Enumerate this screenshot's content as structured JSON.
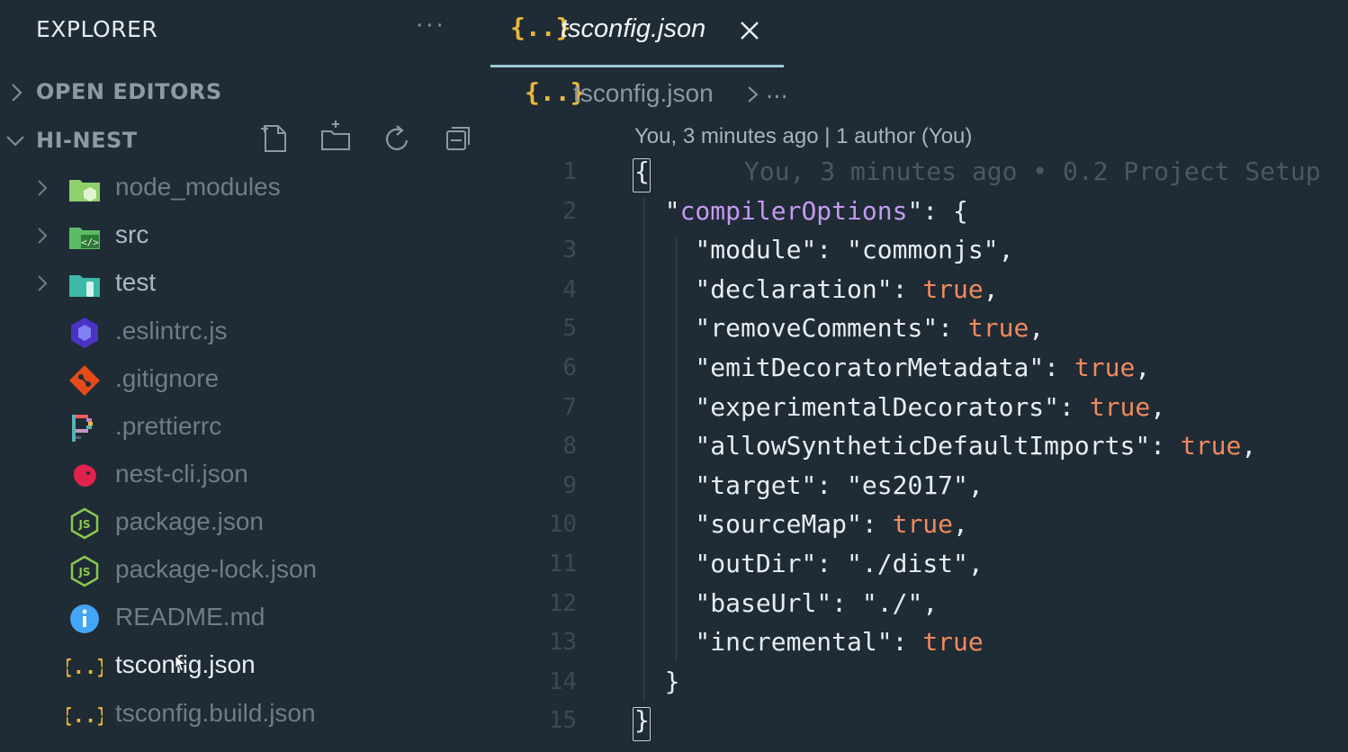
{
  "sidebar": {
    "title": "EXPLORER",
    "more_label": "···",
    "open_editors_label": "OPEN EDITORS",
    "project_label": "HI-NEST",
    "actions": [
      "new-file",
      "new-folder",
      "refresh",
      "collapse-all"
    ],
    "items": [
      {
        "name": "node_modules",
        "type": "folder",
        "icon": "node-modules-folder-icon",
        "color": "#8fd16a"
      },
      {
        "name": "src",
        "type": "folder",
        "icon": "src-folder-icon",
        "color": "#5dbb63"
      },
      {
        "name": "test",
        "type": "folder",
        "icon": "test-folder-icon",
        "color": "#3bb9a6"
      },
      {
        "name": ".eslintrc.js",
        "type": "file",
        "icon": "eslint-icon",
        "color": "#4b32c3"
      },
      {
        "name": ".gitignore",
        "type": "file",
        "icon": "git-icon",
        "color": "#e64a19"
      },
      {
        "name": ".prettierrc",
        "type": "file",
        "icon": "prettier-icon",
        "color": "#c596c7"
      },
      {
        "name": "nest-cli.json",
        "type": "file",
        "icon": "nestjs-icon",
        "color": "#e0234e"
      },
      {
        "name": "package.json",
        "type": "file",
        "icon": "nodejs-icon",
        "color": "#8cc84b"
      },
      {
        "name": "package-lock.json",
        "type": "file",
        "icon": "nodejs-icon",
        "color": "#8cc84b"
      },
      {
        "name": "README.md",
        "type": "file",
        "icon": "info-icon",
        "color": "#42a5f5"
      },
      {
        "name": "tsconfig.json",
        "type": "file",
        "icon": "json-icon",
        "color": "#e8b73c",
        "active": true
      },
      {
        "name": "tsconfig.build.json",
        "type": "file",
        "icon": "json-icon",
        "color": "#e8b73c"
      }
    ]
  },
  "tab": {
    "icon_text": "{..}",
    "label": "tsconfig.json"
  },
  "breadcrumb": {
    "icon_text": "{..}",
    "file": "tsconfig.json",
    "more": "..."
  },
  "codelens": "You, 3 minutes ago | 1 author (You)",
  "blame_ghost": "You, 3 minutes ago • 0.2 Project Setup",
  "line_numbers": [
    "1",
    "2",
    "3",
    "4",
    "5",
    "6",
    "7",
    "8",
    "9",
    "10",
    "11",
    "12",
    "13",
    "14",
    "15"
  ],
  "code": {
    "compiler_key": "compilerOptions",
    "entries": [
      {
        "key": "module",
        "value": "commonjs",
        "kind": "string",
        "comma": true
      },
      {
        "key": "declaration",
        "value": "true",
        "kind": "bool",
        "comma": true
      },
      {
        "key": "removeComments",
        "value": "true",
        "kind": "bool",
        "comma": true
      },
      {
        "key": "emitDecoratorMetadata",
        "value": "true",
        "kind": "bool",
        "comma": true
      },
      {
        "key": "experimentalDecorators",
        "value": "true",
        "kind": "bool",
        "comma": true
      },
      {
        "key": "allowSyntheticDefaultImports",
        "value": "true",
        "kind": "bool",
        "comma": true
      },
      {
        "key": "target",
        "value": "es2017",
        "kind": "string",
        "comma": true
      },
      {
        "key": "sourceMap",
        "value": "true",
        "kind": "bool",
        "comma": true
      },
      {
        "key": "outDir",
        "value": "./dist",
        "kind": "string",
        "comma": true
      },
      {
        "key": "baseUrl",
        "value": "./",
        "kind": "string",
        "comma": true
      },
      {
        "key": "incremental",
        "value": "true",
        "kind": "bool",
        "comma": false
      }
    ]
  },
  "colors": {
    "background": "#1f2b35",
    "accent": "#9fc6da",
    "bool": "#f08a5d",
    "key_highlight": "#c39af2",
    "json_icon": "#e8b73c"
  }
}
